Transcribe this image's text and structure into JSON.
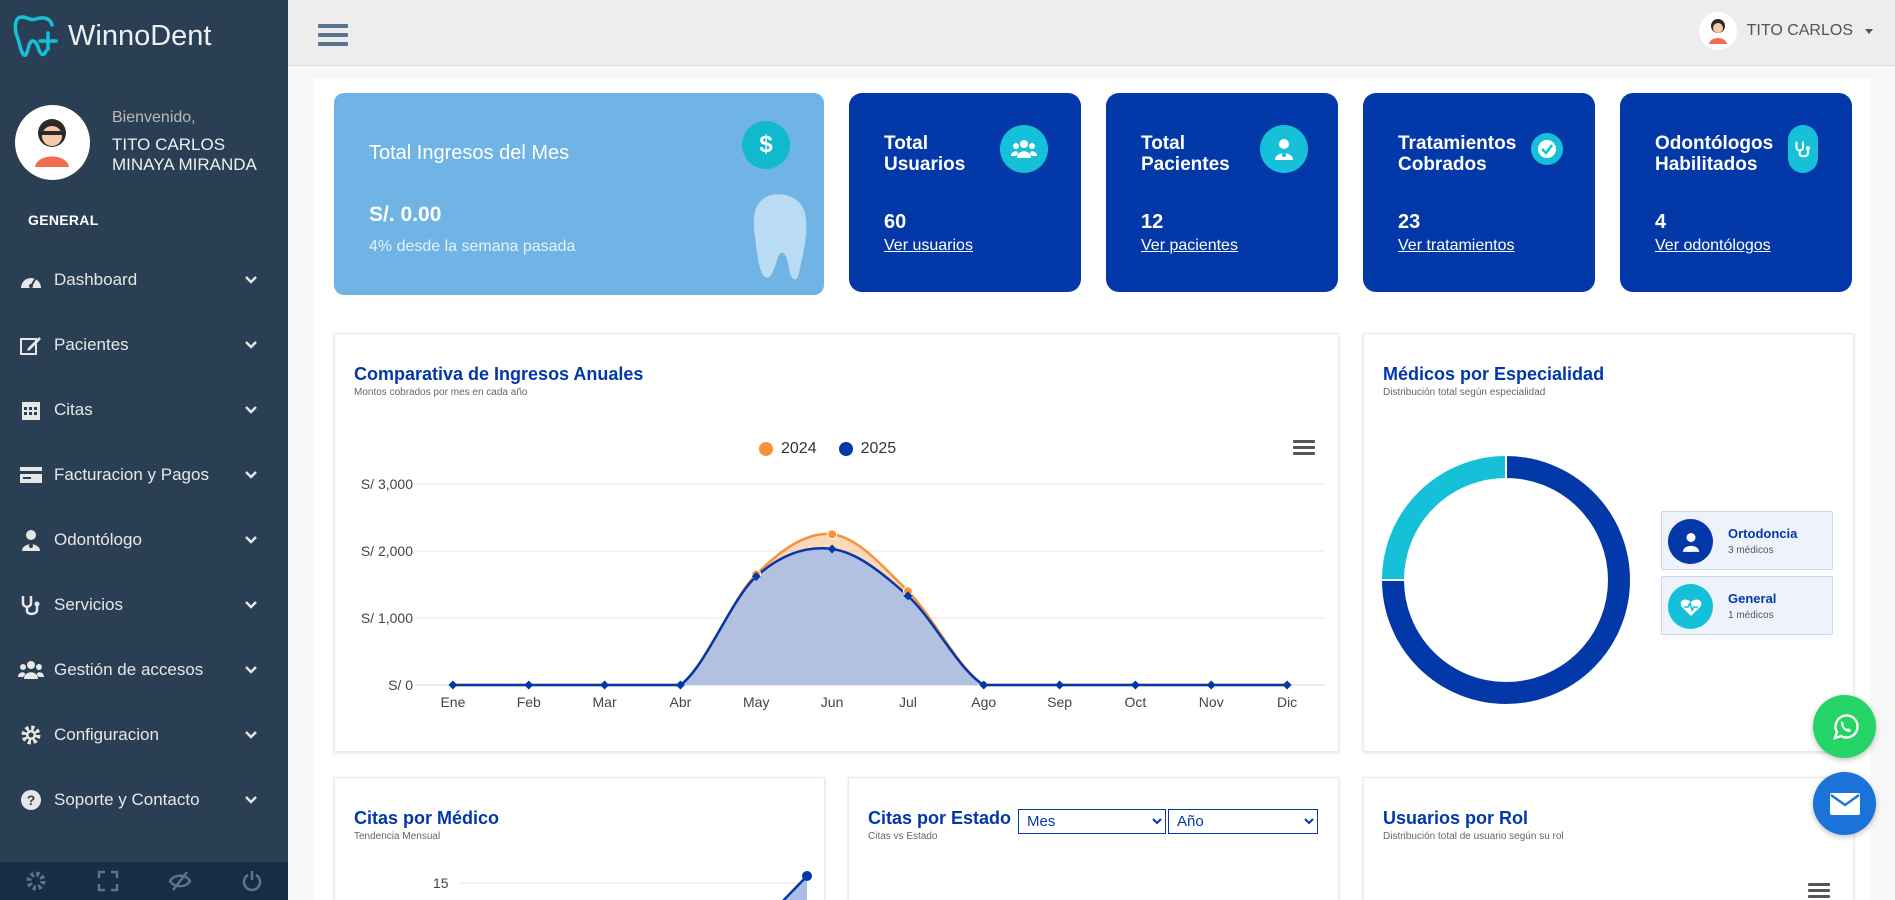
{
  "app": {
    "brand": "WinnoDent"
  },
  "profile": {
    "welcome": "Bienvenido,",
    "name_line1": "TITO CARLOS",
    "name_line2": "MINAYA MIRANDA"
  },
  "sidebar": {
    "section": "GENERAL",
    "items": [
      {
        "label": "Dashboard",
        "icon": "dashboard-icon"
      },
      {
        "label": "Pacientes",
        "icon": "edit-icon"
      },
      {
        "label": "Citas",
        "icon": "calendar-icon"
      },
      {
        "label": "Facturacion y Pagos",
        "icon": "billing-icon"
      },
      {
        "label": "Odontólogo",
        "icon": "doctor-icon"
      },
      {
        "label": "Servicios",
        "icon": "stethoscope-icon"
      },
      {
        "label": "Gestión de accesos",
        "icon": "users-icon"
      },
      {
        "label": "Configuracion",
        "icon": "gear-icon"
      },
      {
        "label": "Soporte y Contacto",
        "icon": "question-icon"
      }
    ]
  },
  "topbar": {
    "user": "TITO CARLOS"
  },
  "kpis": {
    "ingresos": {
      "title": "Total Ingresos del Mes",
      "value": "S/. 0.00",
      "sub": "4% desde la semana pasada",
      "icon": "$"
    },
    "usuarios": {
      "title": "Total Usuarios",
      "value": "60",
      "link": "Ver usuarios"
    },
    "pacientes": {
      "title": "Total Pacientes",
      "value": "12",
      "link": "Ver pacientes"
    },
    "tratamientos": {
      "title": "Tratamientos Cobrados",
      "value": "23",
      "link": "Ver tratamientos"
    },
    "odontologos": {
      "title": "Odontólogos Habilitados",
      "value": "4",
      "link": "Ver odontólogos"
    }
  },
  "ingresos_panel": {
    "title": "Comparativa de Ingresos Anuales",
    "subtitle": "Montos cobrados por mes en cada año"
  },
  "especialidad_panel": {
    "title": "Médicos por Especialidad",
    "subtitle": "Distribución total según especialidad"
  },
  "citas_medico_panel": {
    "title": "Citas por Médico",
    "subtitle": "Tendencia Mensual",
    "tick_15": "15"
  },
  "citas_estado_panel": {
    "title": "Citas por Estado",
    "subtitle": "Citas vs Estado",
    "mes": "Mes",
    "anio": "Año"
  },
  "usuarios_rol_panel": {
    "title": "Usuarios por Rol",
    "subtitle": "Distribución total de usuario según su rol"
  },
  "colors": {
    "sidebar": "#2a3f54",
    "primary": "#0338a8",
    "accent": "#16c0d9",
    "series2024": "#f7923a",
    "series2025": "#0338a8"
  },
  "chart_data": [
    {
      "type": "area",
      "x": [
        "Ene",
        "Feb",
        "Mar",
        "Abr",
        "May",
        "Jun",
        "Jul",
        "Ago",
        "Sep",
        "Oct",
        "Nov",
        "Dic"
      ],
      "series": [
        {
          "name": "2024",
          "values": [
            0,
            0,
            0,
            0,
            1650,
            2250,
            1400,
            0,
            0,
            0,
            0,
            0
          ]
        },
        {
          "name": "2025",
          "values": [
            0,
            0,
            0,
            0,
            1620,
            2030,
            1330,
            0,
            0,
            0,
            0,
            0
          ]
        }
      ],
      "yticks": [
        "S/ 0",
        "S/ 1,000",
        "S/ 2,000",
        "S/ 3,000"
      ],
      "ylim": [
        0,
        3000
      ],
      "legend": "top-center",
      "grid": true
    },
    {
      "type": "pie",
      "categories": [
        "Ortodoncia",
        "General"
      ],
      "values": [
        3,
        1
      ],
      "counts": [
        "3 médicos",
        "1 médicos"
      ],
      "colors": [
        "#0338a8",
        "#16c0d9"
      ]
    }
  ]
}
